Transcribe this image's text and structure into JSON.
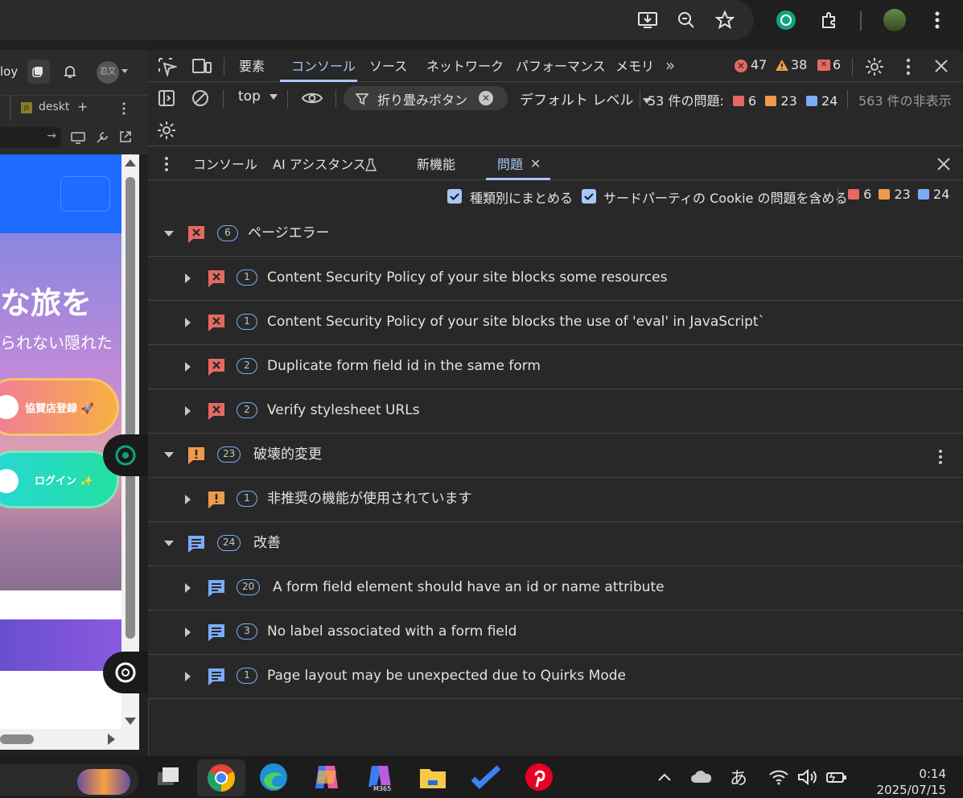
{
  "browser": {
    "page_toolbar_text": "loy",
    "ime_badge": "忍又",
    "tab_label": "deskt",
    "tab_js": "JS"
  },
  "page": {
    "hero_title": "な旅を",
    "hero_sub": "られない隠れた",
    "btn_register": "協賛店登録 🚀",
    "btn_login": "ログイン ✨"
  },
  "devtools": {
    "tabs": [
      "要素",
      "コンソール",
      "ソース",
      "ネットワーク",
      "パフォーマンス",
      "メモリ"
    ],
    "counts": {
      "errors": "47",
      "warnings": "38",
      "issues": "6"
    },
    "toolbar": {
      "context": "top",
      "filter": "折り畳みボタン",
      "level": "デフォルト レベル",
      "issues_text": "53 件の問題:",
      "issues_err": "6",
      "issues_warn": "23",
      "issues_info": "24",
      "hidden": "563 件の非表示"
    },
    "drawer_tabs": [
      "コンソール",
      "AI アシスタンス",
      "新機能",
      "問題"
    ],
    "options": {
      "group_label": "種類別にまとめる",
      "cookie_label": "サードパーティの Cookie の問題を含める",
      "err": "6",
      "warn": "23",
      "info": "24"
    }
  },
  "issues": [
    {
      "kind": "group",
      "icon": "error",
      "count": "6",
      "label": "ページエラー"
    },
    {
      "kind": "item",
      "icon": "error",
      "count": "1",
      "label": "Content Security Policy of your site blocks some resources"
    },
    {
      "kind": "item",
      "icon": "error",
      "count": "1",
      "label": "Content Security Policy of your site blocks the use of 'eval' in JavaScript`"
    },
    {
      "kind": "item",
      "icon": "error",
      "count": "2",
      "label": "Duplicate form field id in the same form"
    },
    {
      "kind": "item",
      "icon": "error",
      "count": "2",
      "label": "Verify stylesheet URLs"
    },
    {
      "kind": "group",
      "icon": "warning",
      "count": "23",
      "label": "破壊的変更"
    },
    {
      "kind": "item",
      "icon": "warning",
      "count": "1",
      "label": "非推奨の機能が使用されています"
    },
    {
      "kind": "group",
      "icon": "info",
      "count": "24",
      "label": "改善"
    },
    {
      "kind": "item",
      "icon": "info",
      "count": "20",
      "label": "A form field element should have an id or name attribute"
    },
    {
      "kind": "item",
      "icon": "info",
      "count": "3",
      "label": "No label associated with a form field"
    },
    {
      "kind": "item",
      "icon": "info",
      "count": "1",
      "label": "Page layout may be unexpected due to Quirks Mode"
    }
  ],
  "taskbar": {
    "ime": "あ",
    "time": "0:14",
    "date": "2025/07/15",
    "m365": "M365"
  },
  "colors": {
    "error": "#e46962",
    "warning": "#ee9a4d",
    "info": "#7cacf8",
    "accent": "#a8c7fa"
  }
}
